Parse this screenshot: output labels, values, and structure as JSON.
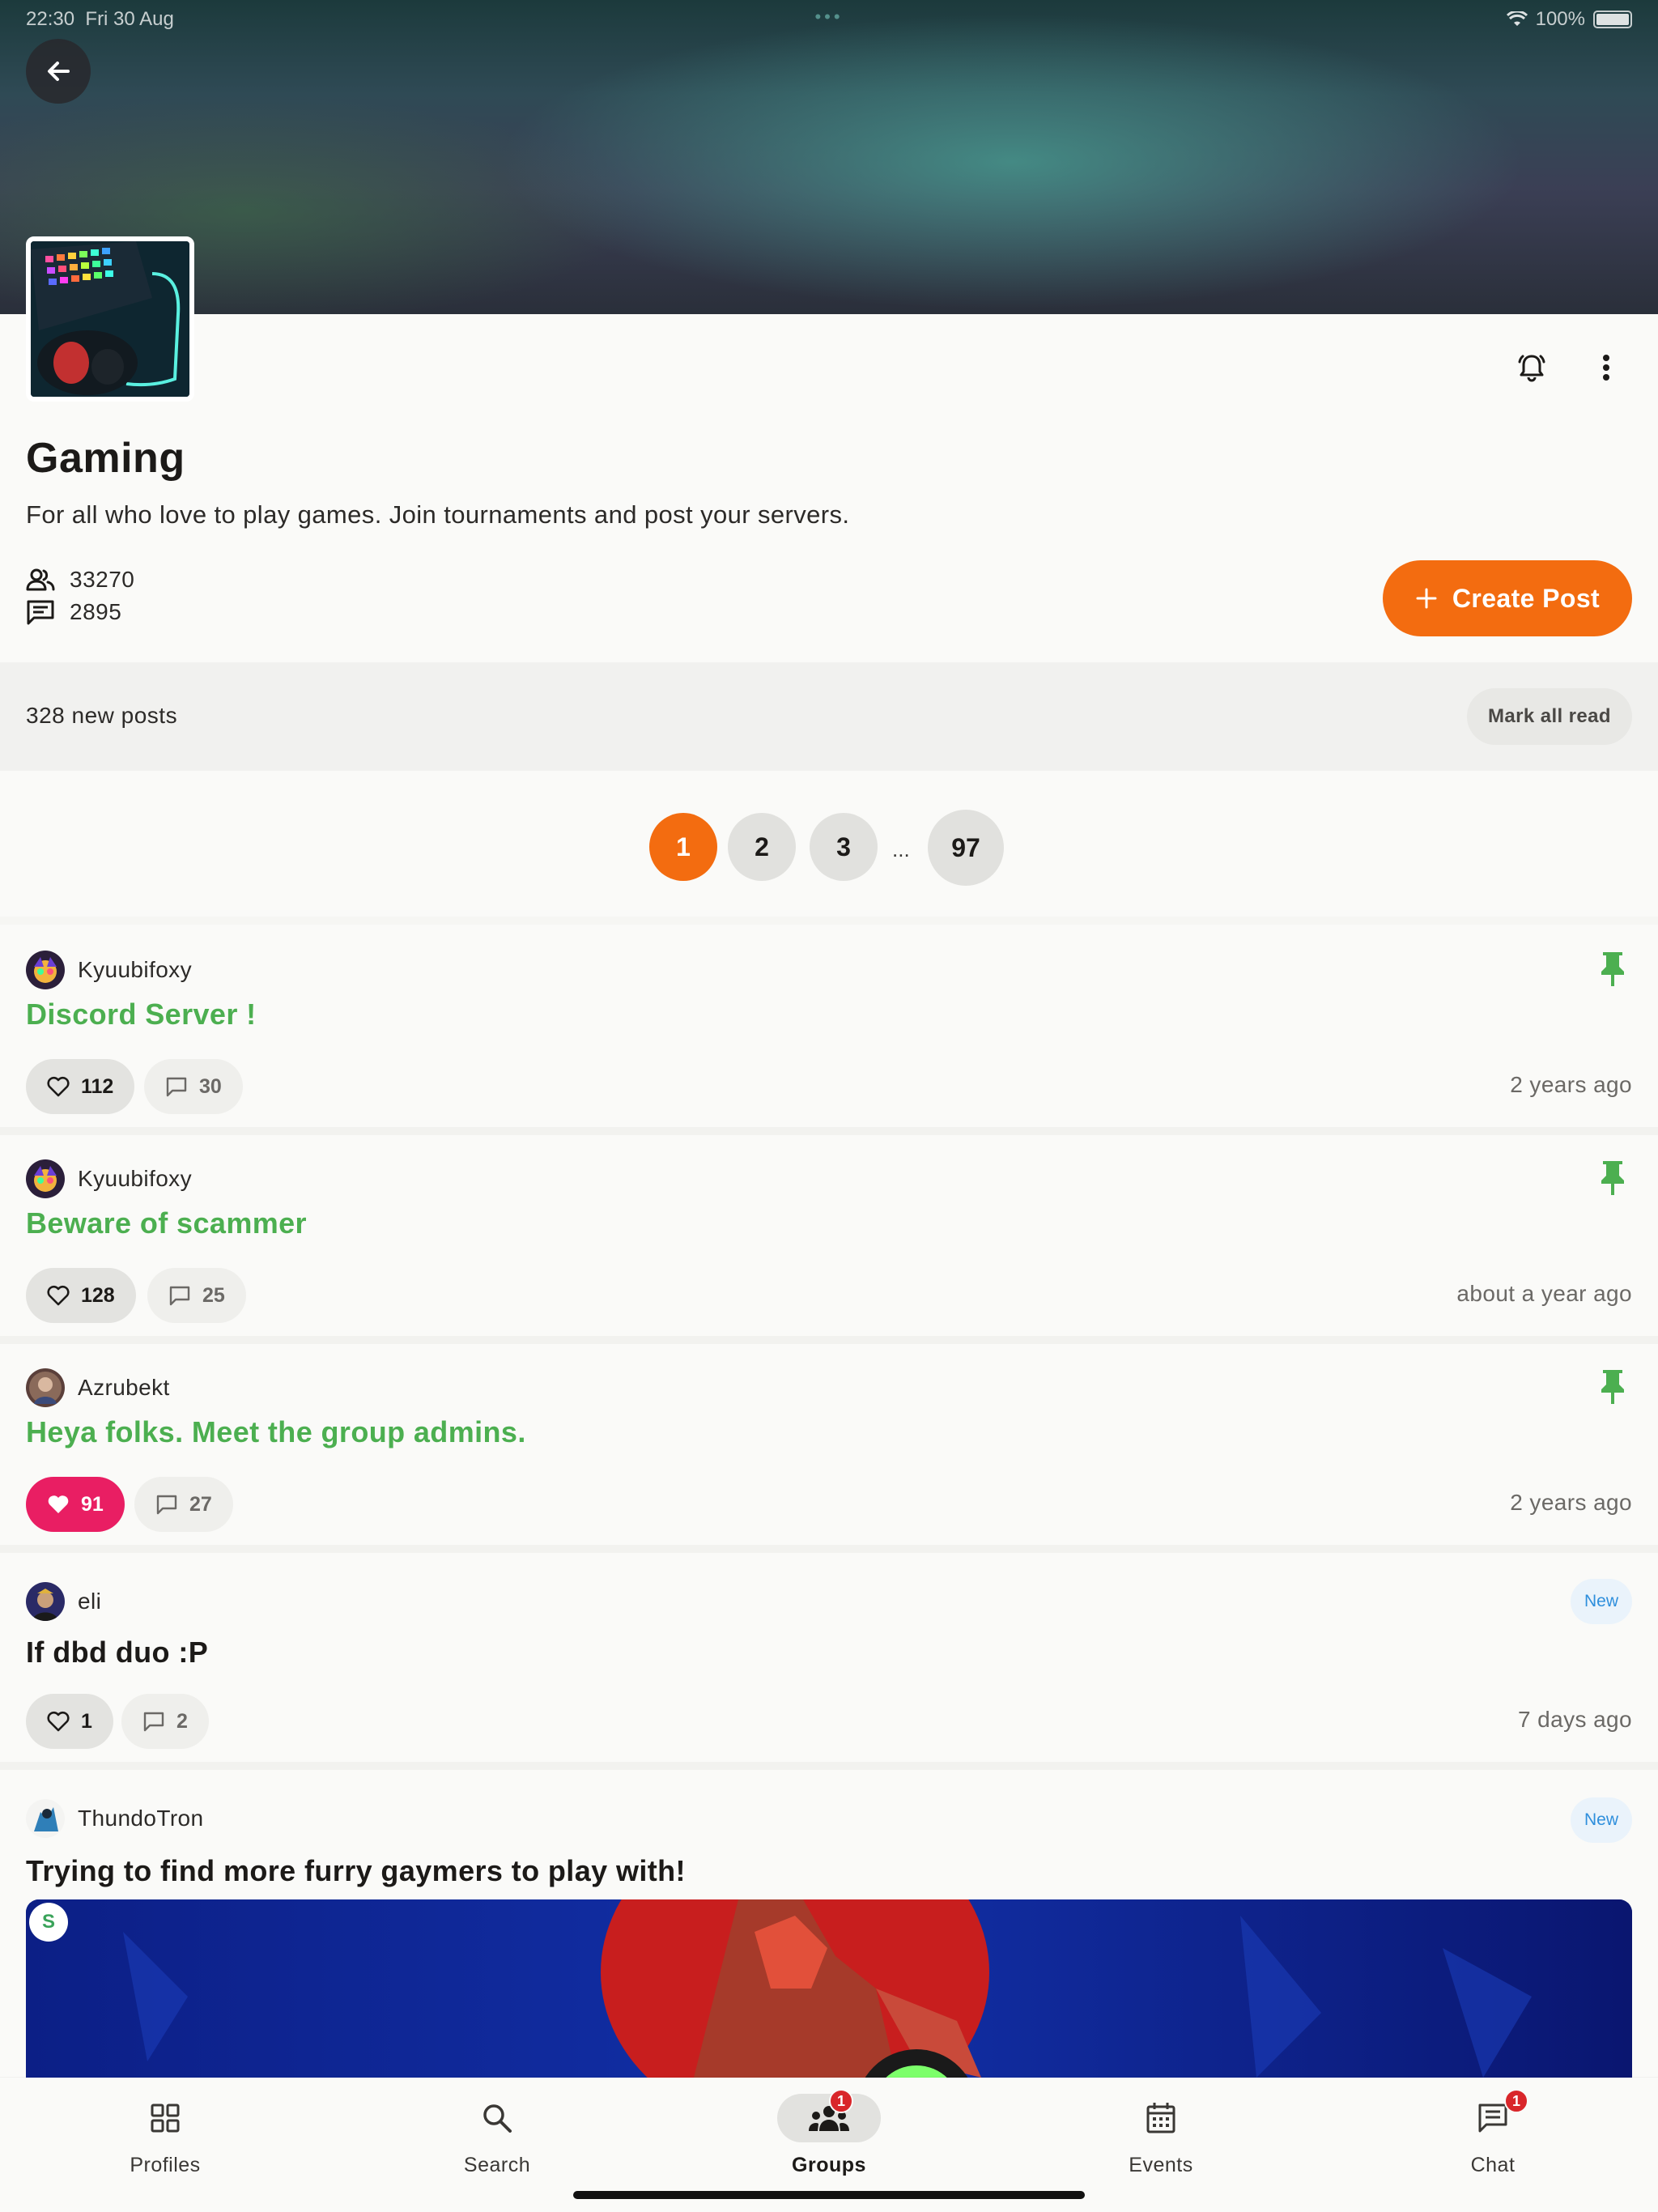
{
  "status_bar": {
    "time": "22:30",
    "date": "Fri 30 Aug",
    "battery": "100%"
  },
  "group": {
    "title": "Gaming",
    "description": "For all who love to play games. Join tournaments and post your servers.",
    "members": "33270",
    "posts": "2895",
    "create_post_label": "Create Post"
  },
  "new_posts": {
    "label": "328 new posts",
    "mark_all_read": "Mark all read"
  },
  "pagination": {
    "pages": [
      "1",
      "2",
      "3",
      "97"
    ],
    "ellipsis": "...",
    "current": "1"
  },
  "posts": [
    {
      "author": "Kyuubifoxy",
      "title": "Discord Server !",
      "likes": "112",
      "comments": "30",
      "time": "2 years ago",
      "pinned": true,
      "liked": false
    },
    {
      "author": "Kyuubifoxy",
      "title": "Beware of scammer",
      "likes": "128",
      "comments": "25",
      "time": "about a year ago",
      "pinned": true,
      "liked": false
    },
    {
      "author": "Azrubekt",
      "title": "Heya folks. Meet the group admins.",
      "likes": "91",
      "comments": "27",
      "time": "2 years ago",
      "pinned": true,
      "liked": true
    },
    {
      "author": "eli",
      "title": "If dbd duo :P",
      "likes": "1",
      "comments": "2",
      "time": "7 days ago",
      "badge": "New",
      "liked": false
    },
    {
      "author": "ThundoTron",
      "title": "Trying to find more furry gaymers to play with!",
      "badge": "New",
      "image_tag": "S"
    }
  ],
  "bottom_nav": [
    {
      "label": "Profiles",
      "icon": "grid-icon"
    },
    {
      "label": "Search",
      "icon": "search-icon"
    },
    {
      "label": "Groups",
      "icon": "groups-icon",
      "badge": "1",
      "active": true
    },
    {
      "label": "Events",
      "icon": "calendar-icon"
    },
    {
      "label": "Chat",
      "icon": "chat-icon",
      "badge": "1"
    }
  ],
  "colors": {
    "accent": "#f36c10",
    "pinned_title": "#4caf50",
    "liked": "#e91e63",
    "new_badge": "#2f8fdc",
    "badge": "#d9262a"
  }
}
